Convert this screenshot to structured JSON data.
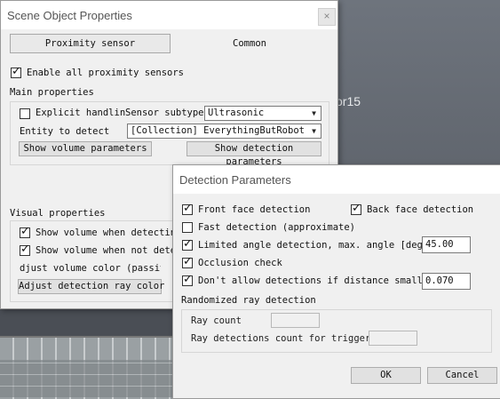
{
  "background": {
    "label": "or15"
  },
  "scene_window": {
    "title": "Scene Object Properties",
    "tabs": [
      {
        "label": "Proximity sensor"
      },
      {
        "label": "Common"
      }
    ],
    "enable_all": {
      "label": "Enable all proximity sensors",
      "checked": true
    },
    "main_properties": {
      "heading": "Main properties",
      "explicit_handling": {
        "label": "Explicit handling",
        "checked": false
      },
      "sensor_subtype_label": "Sensor subtype",
      "sensor_subtype_value": "Ultrasonic",
      "entity_label": "Entity to detect",
      "entity_value": "[Collection] EverythingButRobot",
      "show_volume_button": "Show volume parameters",
      "show_detection_button": "Show detection parameters"
    },
    "visual_properties": {
      "heading": "Visual properties",
      "show_when_detecting": {
        "label": "Show volume when detecting",
        "checked": true
      },
      "show_when_not_detecting": {
        "label": "Show volume when not detecting",
        "checked": true
      },
      "adjust_volume_button": "djust volume color (passive",
      "adjust_ray_button": "Adjust detection ray color"
    }
  },
  "detection_window": {
    "title": "Detection Parameters",
    "front_face": {
      "label": "Front face detection",
      "checked": true
    },
    "back_face": {
      "label": "Back face detection",
      "checked": true
    },
    "fast_detection": {
      "label": "Fast detection (approximate)",
      "checked": false
    },
    "limited_angle": {
      "label": "Limited angle detection, max. angle [deg]",
      "checked": true,
      "value": "45.00"
    },
    "occlusion": {
      "label": "Occlusion check",
      "checked": true
    },
    "min_distance": {
      "label": "Don't allow detections if distance smaller",
      "checked": true,
      "value": "0.070"
    },
    "randomized": {
      "heading": "Randomized ray detection",
      "ray_count_label": "Ray count",
      "ray_count_value": "",
      "ray_detections_label": "Ray detections count for triggeri",
      "ray_detections_value": ""
    },
    "ok_button": "OK",
    "cancel_button": "Cancel"
  }
}
